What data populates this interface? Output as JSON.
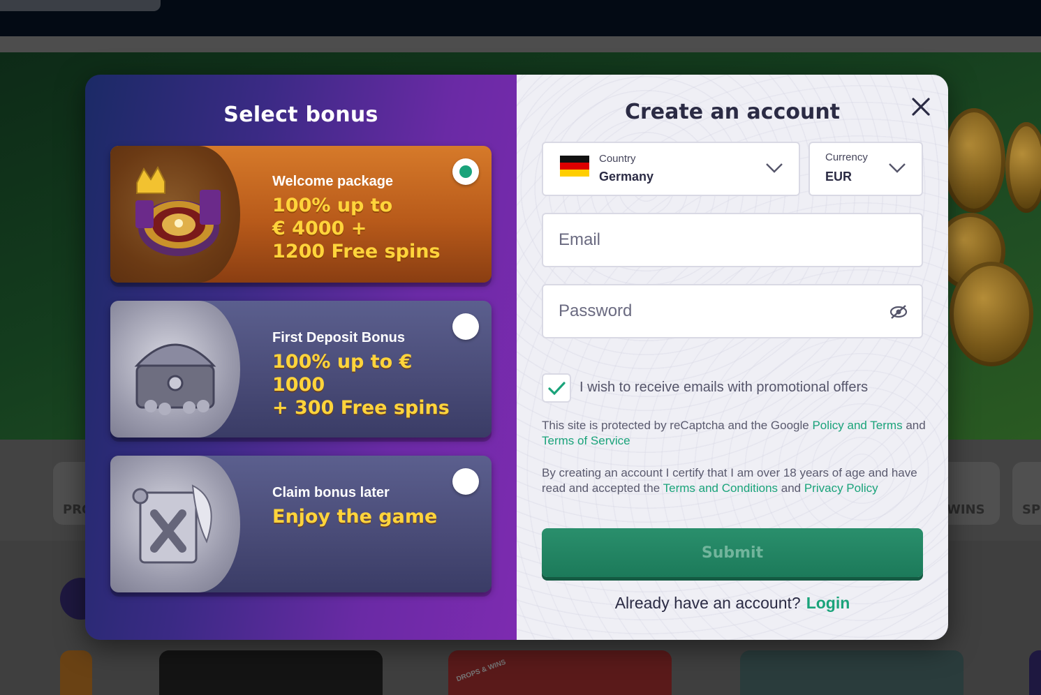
{
  "background": {
    "tabs": [
      {
        "label": "PRO"
      },
      {
        "label": "WINS"
      },
      {
        "label": "SP"
      }
    ],
    "badge_text": "DROPS & WINS"
  },
  "modal": {
    "bonus_panel": {
      "title": "Select bonus",
      "options": [
        {
          "heading": "Welcome package",
          "offer_line1": "100% up to",
          "offer_line2": "€ 4000 +",
          "offer_line3": "1200 Free spins",
          "selected": true
        },
        {
          "heading": "First Deposit Bonus",
          "offer_line1": "100% up to € 1000",
          "offer_line2": "+ 300 Free spins",
          "selected": false
        },
        {
          "heading": "Claim bonus later",
          "offer_line1": "Enjoy the game",
          "selected": false
        }
      ]
    },
    "form": {
      "title": "Create an account",
      "country": {
        "label": "Country",
        "value": "Germany"
      },
      "currency": {
        "label": "Currency",
        "value": "EUR"
      },
      "email": {
        "placeholder": "Email",
        "value": ""
      },
      "password": {
        "placeholder": "Password",
        "value": ""
      },
      "promo_opt_in": {
        "label": "I wish to receive emails with promotional offers",
        "checked": true
      },
      "recaptcha": {
        "prefix": "This site is protected by reCaptcha and the Google ",
        "policy_link": "Policy and Terms",
        "middle": " and ",
        "tos_link": "Terms of Service"
      },
      "age_notice": {
        "prefix": "By creating an account I certify that I am over 18 years of age and have read and accepted the ",
        "terms_link": "Terms and Conditions",
        "middle": " and ",
        "privacy_link": "Privacy Policy"
      },
      "submit_label": "Submit",
      "login_prompt": "Already have an account?",
      "login_link": "Login"
    },
    "colors": {
      "accent": "#1aa37a",
      "offer_yellow": "#ffd43b",
      "title_dark": "#2b2b44"
    }
  }
}
